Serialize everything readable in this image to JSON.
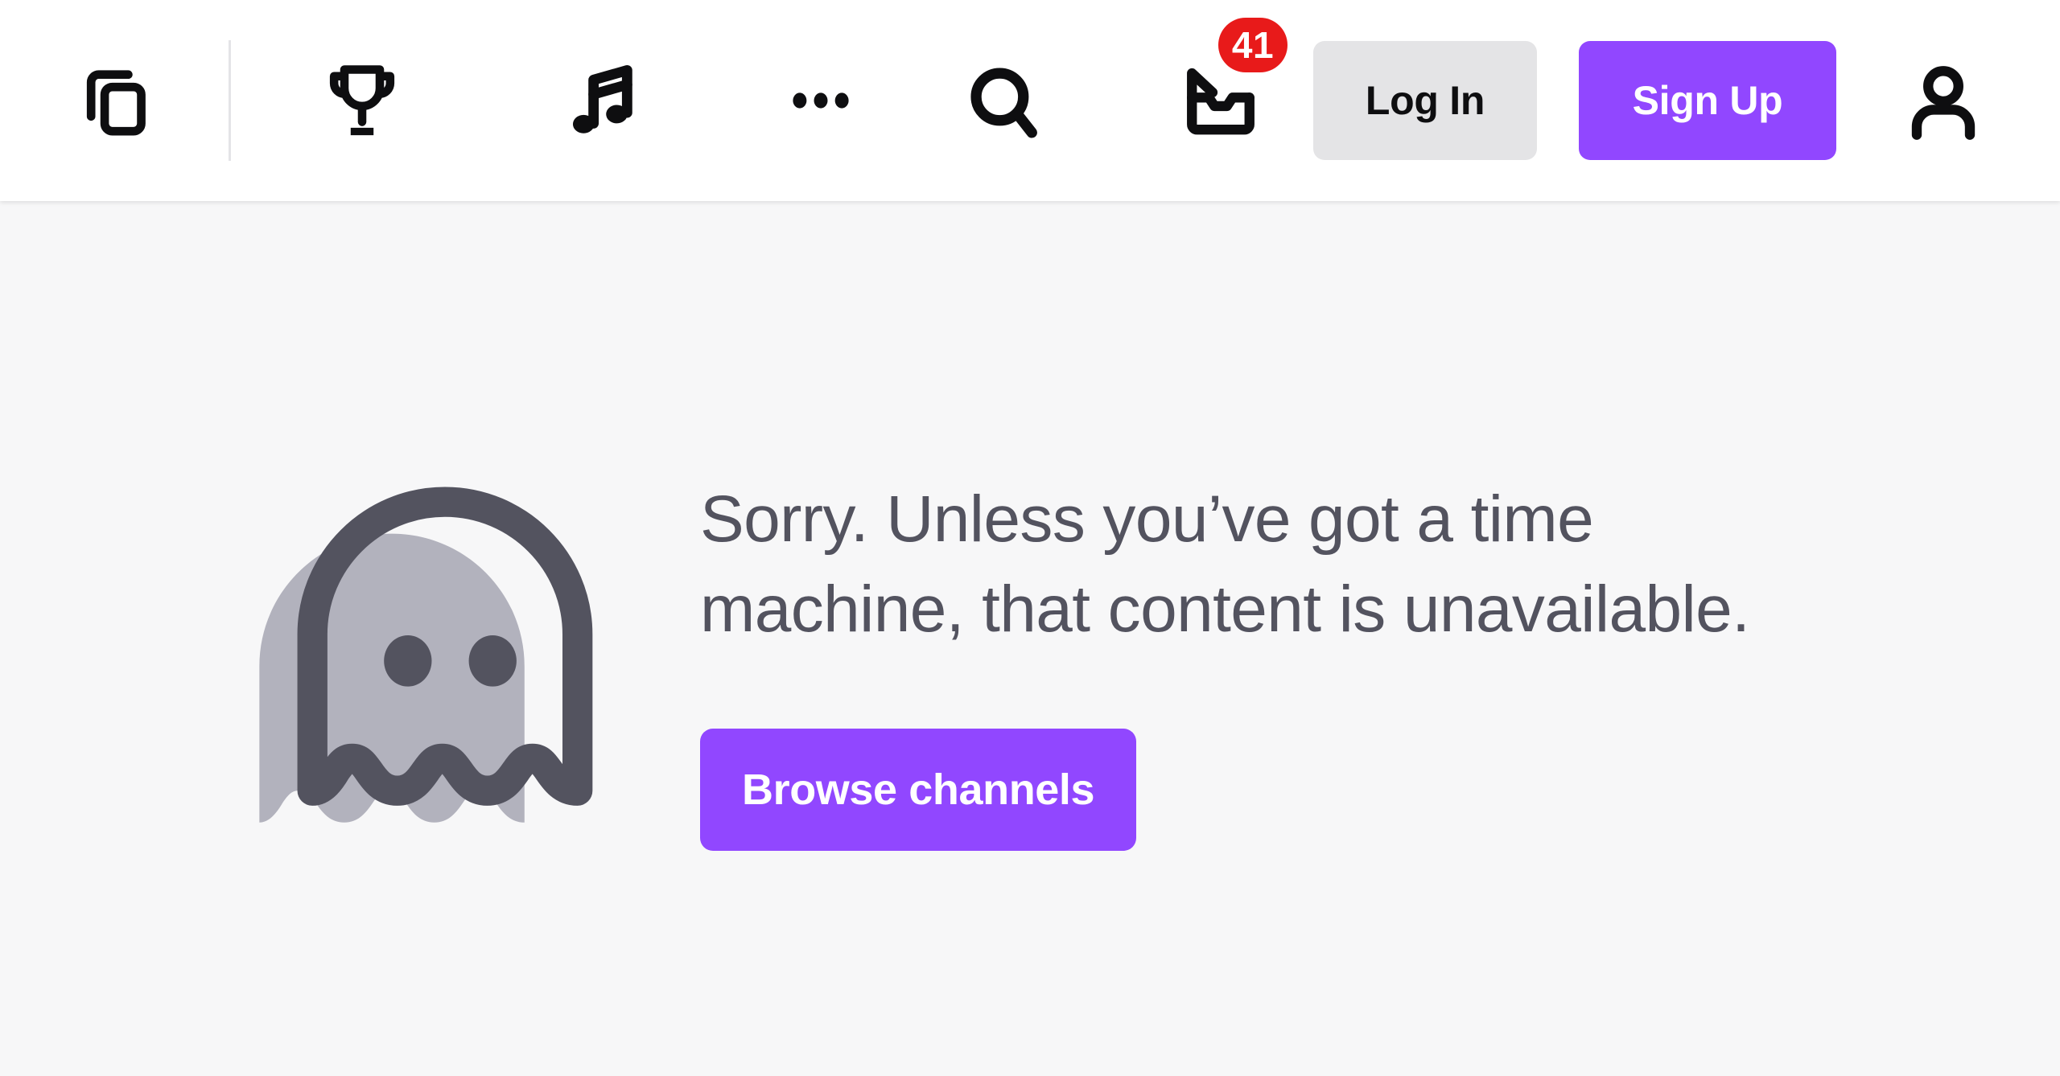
{
  "topnav": {
    "left_items": [
      {
        "name": "copy-icon",
        "label": "Copy"
      },
      {
        "name": "trophy-icon",
        "label": "Trophy"
      },
      {
        "name": "music-icon",
        "label": "Music"
      },
      {
        "name": "more-icon",
        "label": "More"
      }
    ],
    "right_items": [
      {
        "name": "search-icon",
        "label": "Search"
      },
      {
        "name": "inbox-icon",
        "label": "Inbox"
      },
      {
        "name": "avatar-icon",
        "label": "Account"
      }
    ],
    "notification_badge": "41",
    "login_label": "Log In",
    "signup_label": "Sign Up"
  },
  "main": {
    "illustration": "ghost-illustration",
    "message": "Sorry. Unless you’ve got a time machine, that content is unavailable.",
    "browse_label": "Browse channels"
  },
  "colors": {
    "accent_purple": "#9147ff",
    "badge_red": "#e81a1a",
    "login_gray": "#e4e4e6",
    "text_slate": "#53535f",
    "ghost_light": "#b2b2bd",
    "ghost_dark": "#53535f",
    "nav_background": "#ffffff",
    "page_background": "#f7f7f8"
  }
}
